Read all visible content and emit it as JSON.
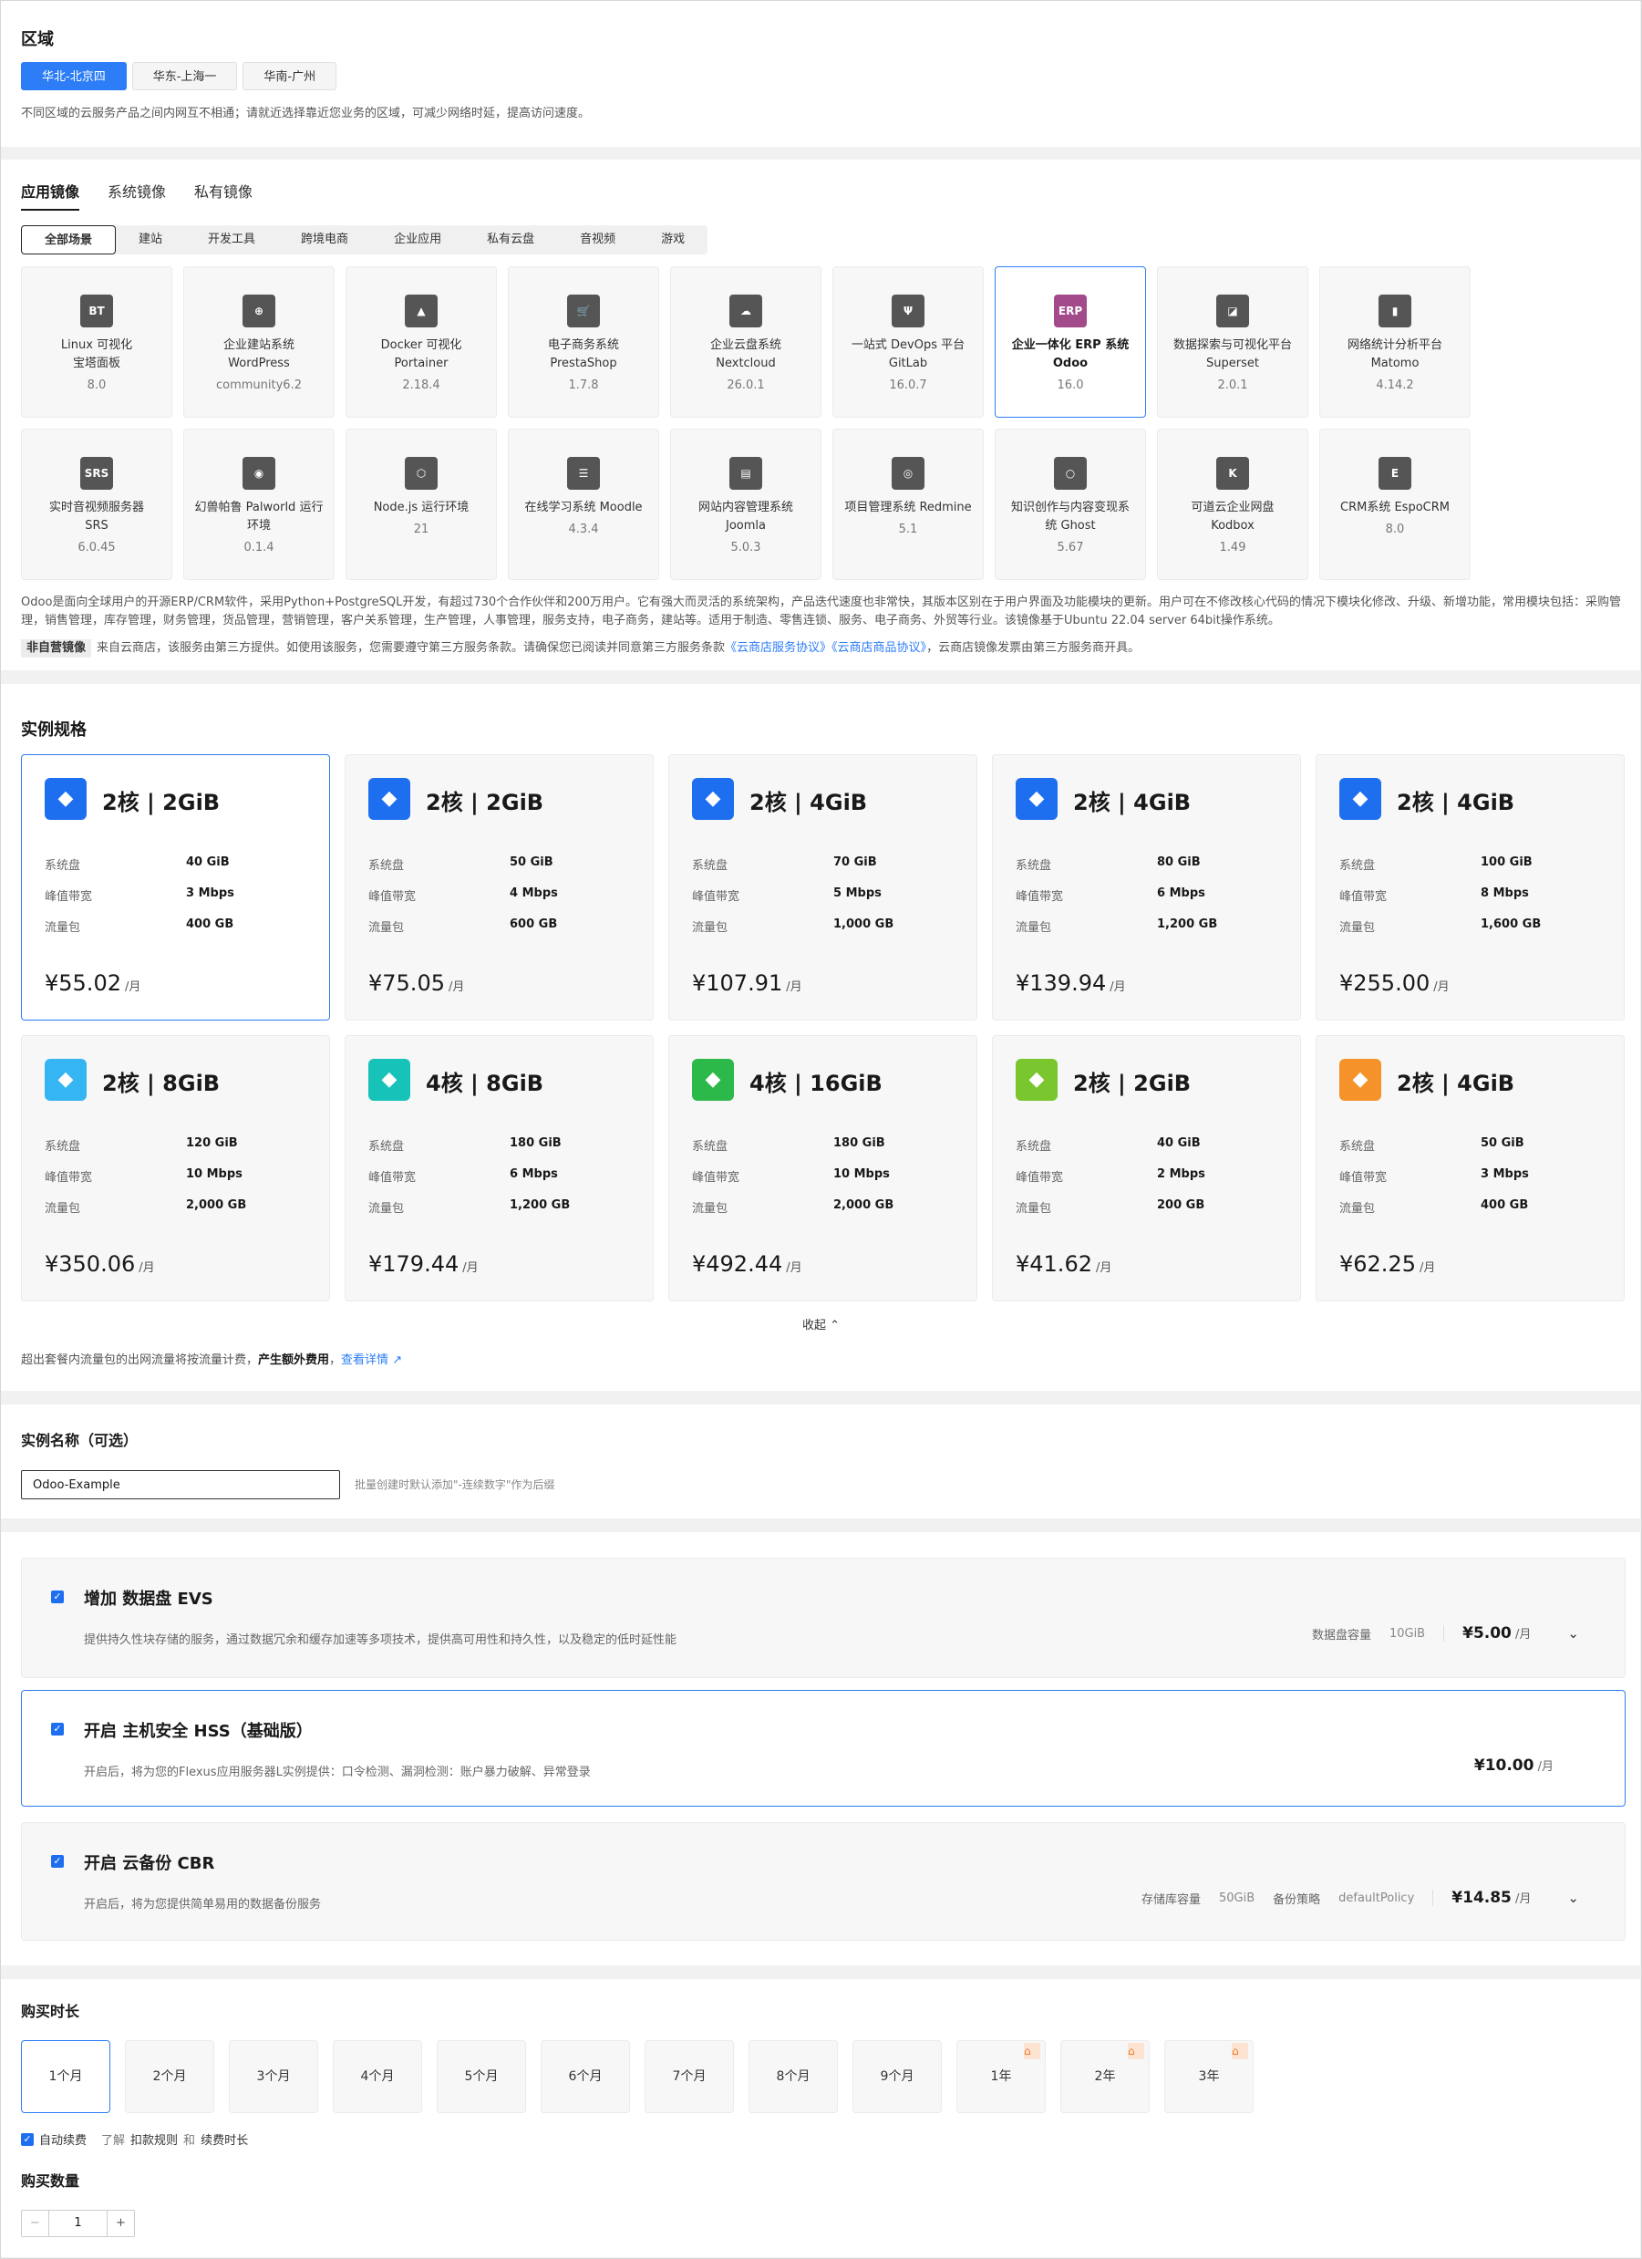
{
  "region": {
    "title": "区域",
    "options": [
      "华北-北京四",
      "华东-上海一",
      "华南-广州"
    ],
    "selected": "华北-北京四",
    "note": "不同区域的云服务产品之间内网互不相通；请就近选择靠近您业务的区域，可减少网络时延，提高访问速度。"
  },
  "image": {
    "tabs": [
      "应用镜像",
      "系统镜像",
      "私有镜像"
    ],
    "active_tab": "应用镜像",
    "categories": [
      "全部场景",
      "建站",
      "开发工具",
      "跨境电商",
      "企业应用",
      "私有云盘",
      "音视频",
      "游戏"
    ],
    "active_category": "全部场景",
    "items": [
      {
        "icon": "bt-icon",
        "glyph": "BT",
        "color": "#555555",
        "name1": "Linux 可视化",
        "name2": "宝塔面板",
        "version": "8.0"
      },
      {
        "icon": "globe-icon",
        "glyph": "⊕",
        "color": "#555555",
        "name1": "企业建站系统",
        "name2": "WordPress",
        "version": "community6.2"
      },
      {
        "icon": "portainer-icon",
        "glyph": "▲",
        "color": "#555555",
        "name1": "Docker 可视化",
        "name2": "Portainer",
        "version": "2.18.4"
      },
      {
        "icon": "cart-icon",
        "glyph": "🛒",
        "color": "#555555",
        "name1": "电子商务系统",
        "name2": "PrestaShop",
        "version": "1.7.8"
      },
      {
        "icon": "cloud-icon",
        "glyph": "☁",
        "color": "#555555",
        "name1": "企业云盘系统",
        "name2": "Nextcloud",
        "version": "26.0.1"
      },
      {
        "icon": "gitlab-icon",
        "glyph": "Ψ",
        "color": "#555555",
        "name1": "一站式 DevOps 平台",
        "name2": "GitLab",
        "version": "16.0.7"
      },
      {
        "icon": "erp-icon",
        "glyph": "ERP",
        "color": "#a24a8a",
        "name1": "企业一体化 ERP 系统",
        "name2": "Odoo",
        "version": "16.0"
      },
      {
        "icon": "chart-icon",
        "glyph": "◪",
        "color": "#555555",
        "name1": "数据探索与可视化平台",
        "name2": "Superset",
        "version": "2.0.1"
      },
      {
        "icon": "bar-chart-icon",
        "glyph": "▮",
        "color": "#555555",
        "name1": "网络统计分析平台",
        "name2": "Matomo",
        "version": "4.14.2"
      },
      {
        "icon": "srs-icon",
        "glyph": "SRS",
        "color": "#555555",
        "name1": "实时音视频服务器",
        "name2": "SRS",
        "version": "6.0.45"
      },
      {
        "icon": "palworld-icon",
        "glyph": "◉",
        "color": "#555555",
        "name1": "幻兽帕鲁 Palworld 运行",
        "name2": "环境",
        "version": "0.1.4"
      },
      {
        "icon": "nodejs-icon",
        "glyph": "⬡",
        "color": "#555555",
        "name1": "Node.js 运行环境",
        "name2": "",
        "version": "21"
      },
      {
        "icon": "moodle-icon",
        "glyph": "☰",
        "color": "#555555",
        "name1": "在线学习系统 Moodle",
        "name2": "",
        "version": "4.3.4"
      },
      {
        "icon": "joomla-icon",
        "glyph": "▤",
        "color": "#555555",
        "name1": "网站内容管理系统",
        "name2": "Joomla",
        "version": "5.0.3"
      },
      {
        "icon": "redmine-icon",
        "glyph": "◎",
        "color": "#555555",
        "name1": "项目管理系统 Redmine",
        "name2": "",
        "version": "5.1"
      },
      {
        "icon": "ghost-icon",
        "glyph": "○",
        "color": "#555555",
        "name1": "知识创作与内容变现系",
        "name2": "统 Ghost",
        "version": "5.67"
      },
      {
        "icon": "kodbox-icon",
        "glyph": "K",
        "color": "#555555",
        "name1": "可道云企业网盘",
        "name2": "Kodbox",
        "version": "1.49"
      },
      {
        "icon": "espocrm-icon",
        "glyph": "E",
        "color": "#555555",
        "name1": "CRM系统 EspoCRM",
        "name2": "",
        "version": "8.0"
      }
    ],
    "selected": "Odoo",
    "description": "Odoo是面向全球用户的开源ERP/CRM软件，采用Python+PostgreSQL开发，有超过730个合作伙伴和200万用户。它有强大而灵活的系统架构，产品迭代速度也非常快，其版本区别在于用户界面及功能模块的更新。用户可在不修改核心代码的情况下模块化修改、升级、新增功能，常用模块包括：采购管理，销售管理，库存管理，财务管理，货品管理，营销管理，客户关系管理，生产管理，人事管理，服务支持，电子商务，建站等。适用于制造、零售连锁、服务、电子商务、外贸等行业。该镜像基于Ubuntu 22.04 server 64bit操作系统。",
    "tag": "非自营镜像",
    "notice_prefix": "来自云商店，该服务由第三方提供。如使用该服务，您需要遵守第三方服务条款。请确保您已阅读并同意第三方服务条款",
    "link1": "《云商店服务协议》",
    "link2": "《云商店商品协议》",
    "notice_suffix": "，云商店镜像发票由第三方服务商开具。"
  },
  "spec": {
    "title": "实例规格",
    "cards": [
      {
        "name": "2核 | 2GiB",
        "disk": "40 GiB",
        "bw": "3 Mbps",
        "traffic": "400 GB",
        "price": "¥55.02",
        "color": "#1e6ff0"
      },
      {
        "name": "2核 | 2GiB",
        "disk": "50 GiB",
        "bw": "4 Mbps",
        "traffic": "600 GB",
        "price": "¥75.05",
        "color": "#1e6ff0"
      },
      {
        "name": "2核 | 4GiB",
        "disk": "70 GiB",
        "bw": "5 Mbps",
        "traffic": "1,000 GB",
        "price": "¥107.91",
        "color": "#1e6ff0"
      },
      {
        "name": "2核 | 4GiB",
        "disk": "80 GiB",
        "bw": "6 Mbps",
        "traffic": "1,200 GB",
        "price": "¥139.94",
        "color": "#1e6ff0"
      },
      {
        "name": "2核 | 4GiB",
        "disk": "100 GiB",
        "bw": "8 Mbps",
        "traffic": "1,600 GB",
        "price": "¥255.00",
        "color": "#1e6ff0"
      },
      {
        "name": "2核 | 8GiB",
        "disk": "120 GiB",
        "bw": "10 Mbps",
        "traffic": "2,000 GB",
        "price": "¥350.06",
        "color": "#35b5f2"
      },
      {
        "name": "4核 | 8GiB",
        "disk": "180 GiB",
        "bw": "6 Mbps",
        "traffic": "1,200 GB",
        "price": "¥179.44",
        "color": "#17c2b8"
      },
      {
        "name": "4核 | 16GiB",
        "disk": "180 GiB",
        "bw": "10 Mbps",
        "traffic": "2,000 GB",
        "price": "¥492.44",
        "color": "#2db84a"
      },
      {
        "name": "2核 | 2GiB",
        "disk": "40 GiB",
        "bw": "2 Mbps",
        "traffic": "200 GB",
        "price": "¥41.62",
        "color": "#7ac62e"
      },
      {
        "name": "2核 | 4GiB",
        "disk": "50 GiB",
        "bw": "3 Mbps",
        "traffic": "400 GB",
        "price": "¥62.25",
        "color": "#f5932a"
      }
    ],
    "labels": {
      "disk": "系统盘",
      "bw": "峰值带宽",
      "traffic": "流量包",
      "unit": "/月"
    },
    "collapse": "收起",
    "footnote": "超出套餐内流量包的出网流量将按流量计费，",
    "footnote_bold": "产生额外费用",
    "footnote_link": "查看详情"
  },
  "name": {
    "title": "实例名称（可选）",
    "value": "Odoo-Example",
    "hint": "批量创建时默认添加\"-连续数字\"作为后缀"
  },
  "addons": [
    {
      "title": "增加 数据盘 EVS",
      "desc": "提供持久性块存储的服务，通过数据冗余和缓存加速等多项技术，提供高可用性和持久性，以及稳定的低时延性能",
      "k1": "数据盘容量",
      "v1": "10GiB",
      "k2": "",
      "v2": "",
      "price": "¥5.00",
      "unit": "/月"
    },
    {
      "title": "开启 主机安全 HSS（基础版）",
      "desc": "开启后，将为您的Flexus应用服务器L实例提供：口令检测、漏洞检测：账户暴力破解、异常登录",
      "k1": "",
      "v1": "",
      "k2": "",
      "v2": "",
      "price": "¥10.00",
      "unit": "/月"
    },
    {
      "title": "开启 云备份 CBR",
      "desc": "开启后，将为您提供简单易用的数据备份服务",
      "k1": "存储库容量",
      "v1": "50GiB",
      "k2": "备份策略",
      "v2": "defaultPolicy",
      "price": "¥14.85",
      "unit": "/月"
    }
  ],
  "duration": {
    "title": "购买时长",
    "options": [
      "1个月",
      "2个月",
      "3个月",
      "4个月",
      "5个月",
      "6个月",
      "7个月",
      "8个月",
      "9个月",
      "1年",
      "2年",
      "3年"
    ],
    "selected": "1个月",
    "auto_renew": "自动续费",
    "learn": "了解",
    "rule1": "扣款规则",
    "and": "和",
    "rule2": "续费时长"
  },
  "quantity": {
    "title": "购买数量",
    "value": "1",
    "minus": "−",
    "plus": "+"
  }
}
